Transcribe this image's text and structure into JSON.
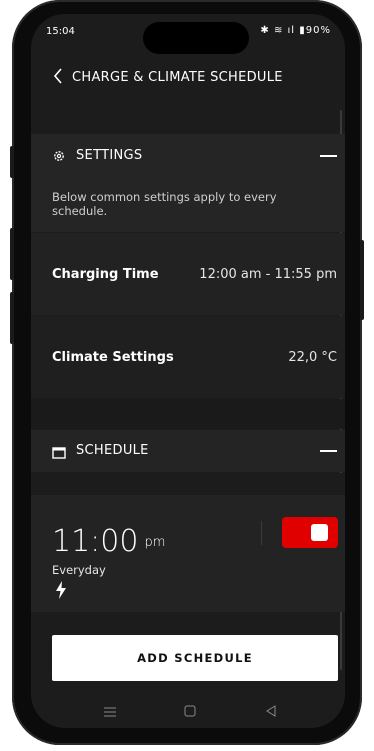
{
  "status_bar": {
    "time": "15:04",
    "indicators": "✱ ≋ ıl ▮",
    "battery": "90%"
  },
  "header": {
    "back_icon": "chevron-left-icon",
    "title": "CHARGE & CLIMATE SCHEDULE"
  },
  "settings": {
    "icon": "gear-icon",
    "title": "SETTINGS",
    "description": "Below common settings apply to every schedule.",
    "charging_time_label": "Charging Time",
    "charging_time_value": "12:00 am - 11:55 pm",
    "climate_label": "Climate Settings",
    "climate_value": "22,0 °C"
  },
  "schedule": {
    "icon": "calendar-icon",
    "title": "SCHEDULE",
    "time": "11:00",
    "ampm": "pm",
    "repeat": "Everyday",
    "type_icon": "lightning-icon",
    "enabled": true
  },
  "actions": {
    "add_schedule": "ADD SCHEDULE"
  },
  "colors": {
    "accent": "#e10000",
    "background": "#1c1c1c"
  }
}
